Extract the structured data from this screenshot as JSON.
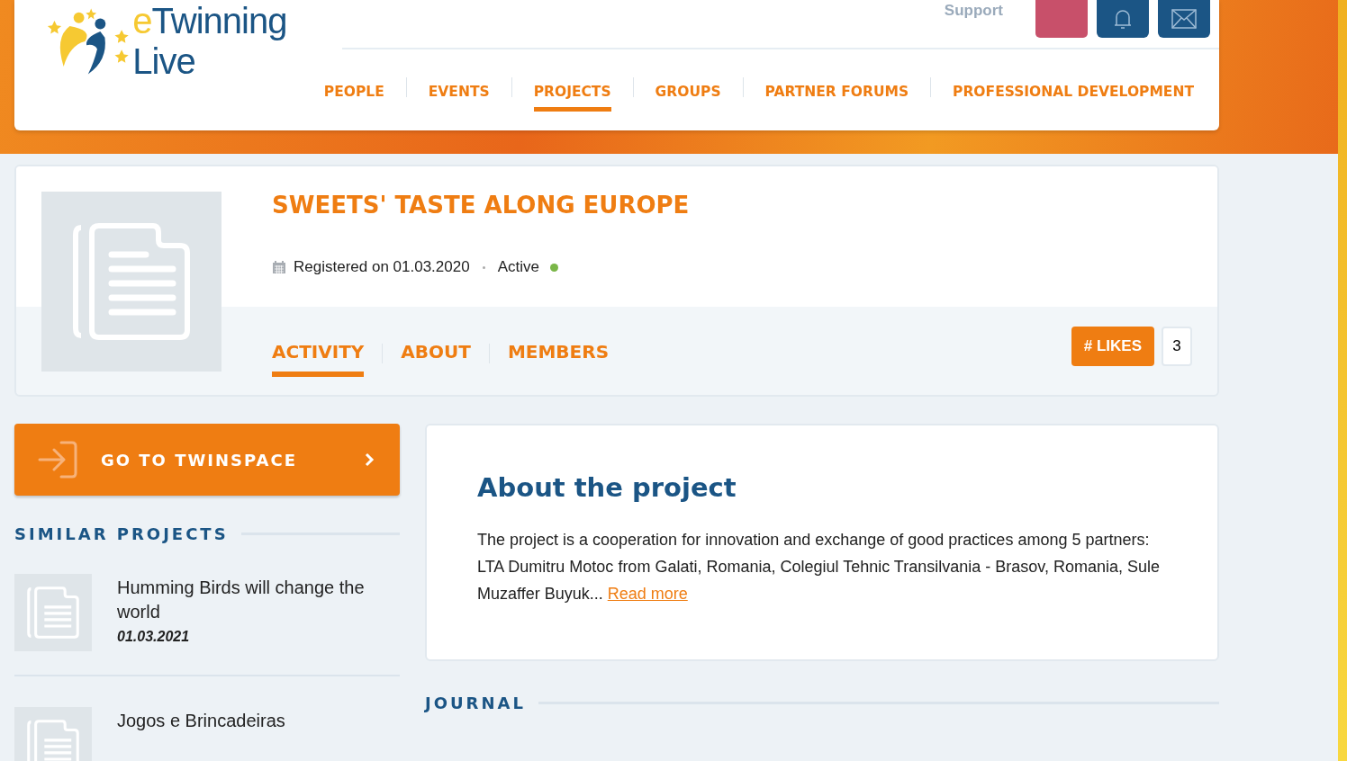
{
  "header": {
    "logo": "eTwinning Live",
    "support_link": "Support",
    "nav": [
      {
        "label": "PEOPLE",
        "selected": false
      },
      {
        "label": "EVENTS",
        "selected": false
      },
      {
        "label": "PROJECTS",
        "selected": true
      },
      {
        "label": "GROUPS",
        "selected": false
      },
      {
        "label": "PARTNER FORUMS",
        "selected": false
      },
      {
        "label": "PROFESSIONAL DEVELOPMENT",
        "selected": false
      }
    ]
  },
  "project": {
    "title": "SWEETS' TASTE ALONG EUROPE",
    "registered": "Registered on 01.03.2020",
    "status": {
      "label": "Active",
      "color": "#7ab648"
    },
    "tabs": [
      {
        "label": "ACTIVITY",
        "selected": true
      },
      {
        "label": "ABOUT",
        "selected": false
      },
      {
        "label": "MEMBERS",
        "selected": false
      }
    ],
    "likes_button": "# LIKES",
    "likes_count": "3"
  },
  "twinspace_button": "GO TO TWINSPACE",
  "similar_projects": {
    "heading": "SIMILAR PROJECTS",
    "items": [
      {
        "title": "Humming Birds will change the world",
        "date": "01.03.2021"
      },
      {
        "title": "Jogos e Brincadeiras"
      }
    ]
  },
  "about": {
    "heading": "About the project",
    "text": "The project is a cooperation for innovation and exchange of good practices among 5 partners: LTA Dumitru Motoc from Galati, Romania, Colegiul Tehnic Transilvania - Brasov, Romania, Sule Muzaffer Buyuk...",
    "read_more": "Read more"
  },
  "journal": {
    "heading": "JOURNAL"
  }
}
